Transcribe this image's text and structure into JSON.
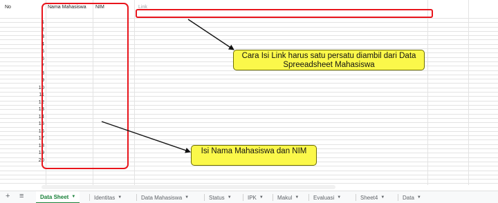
{
  "headers": {
    "no": "No",
    "name": "Nama Mahasiswa",
    "nim": "NIM",
    "link": "Link"
  },
  "row_numbers": [
    "1",
    "2",
    "3",
    "4",
    "5",
    "6",
    "7",
    "8",
    "9",
    "10",
    "11",
    "12",
    "13",
    "14",
    "15",
    "16",
    "17",
    "18",
    "19",
    "20"
  ],
  "callouts": {
    "link": "Cara Isi Link harus satu persatu diambil dari Data Spreeadsheet Mahasiswa",
    "name": "Isi Nama Mahasiswa dan NIM"
  },
  "colors": {
    "annotation_red": "#e8141b",
    "callout_yellow": "#fbf84a",
    "active_tab": "#188038"
  },
  "toolbar": {
    "add_icon": "plus-icon",
    "menu_icon": "list-icon"
  },
  "sheets": [
    {
      "label": "Data Sheet",
      "active": true
    },
    {
      "label": "Identitas",
      "active": false
    },
    {
      "label": "Data Mahasiswa",
      "active": false
    },
    {
      "label": "Status",
      "active": false
    },
    {
      "label": "IPK",
      "active": false
    },
    {
      "label": "Makul",
      "active": false
    },
    {
      "label": "Evaluasi",
      "active": false
    },
    {
      "label": "Sheet4",
      "active": false
    },
    {
      "label": "Data",
      "active": false
    }
  ]
}
